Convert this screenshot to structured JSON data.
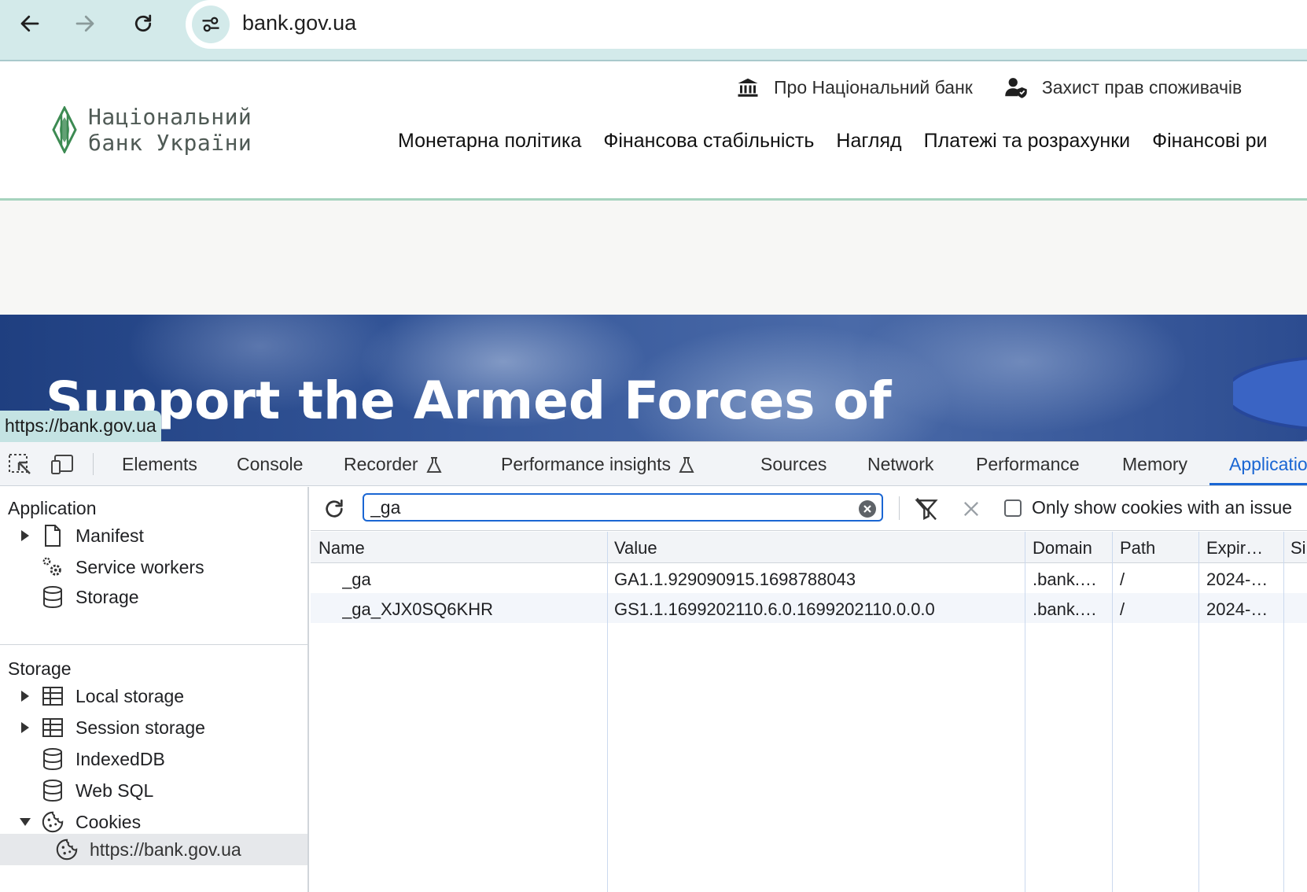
{
  "browser": {
    "url": "bank.gov.ua",
    "status_url": "https://bank.gov.ua"
  },
  "site": {
    "logo_line1": "Національний",
    "logo_line2": "банк України",
    "top_links": [
      "Про Національний банк",
      "Захист прав споживачів"
    ],
    "menu": [
      "Монетарна політика",
      "Фінансова стабільність",
      "Нагляд",
      "Платежі та розрахунки",
      "Фінансові ри"
    ],
    "banner_title": "Support the Armed Forces of Ukraine and People Affected by"
  },
  "devtools": {
    "tabs": [
      "Elements",
      "Console",
      "Recorder",
      "Performance insights",
      "Sources",
      "Network",
      "Performance",
      "Memory",
      "Applicatio"
    ],
    "active_tab": "Applicatio",
    "sidebar": {
      "application_heading": "Application",
      "application_items": [
        "Manifest",
        "Service workers",
        "Storage"
      ],
      "storage_heading": "Storage",
      "storage_items": [
        "Local storage",
        "Session storage",
        "IndexedDB",
        "Web SQL",
        "Cookies"
      ],
      "cookie_origin": "https://bank.gov.ua"
    },
    "toolbar": {
      "filter_value": "_ga",
      "only_issues_label": "Only show cookies with an issue"
    },
    "table": {
      "columns": [
        "Name",
        "Value",
        "Domain",
        "Path",
        "Expir…",
        "Si"
      ],
      "rows": [
        [
          "_ga",
          "GA1.1.929090915.1698788043",
          ".bank.…",
          "/",
          "2024-…"
        ],
        [
          "_ga_XJX0SQ6KHR",
          "GS1.1.1699202110.6.0.1699202110.0.0.0",
          ".bank.…",
          "/",
          "2024-…"
        ]
      ]
    }
  },
  "colors": {
    "chrome_bg": "#d3eaea",
    "accent_blue": "#1a66d3",
    "logo_green": "#3c8a52",
    "banner_blue": "#35579a"
  }
}
